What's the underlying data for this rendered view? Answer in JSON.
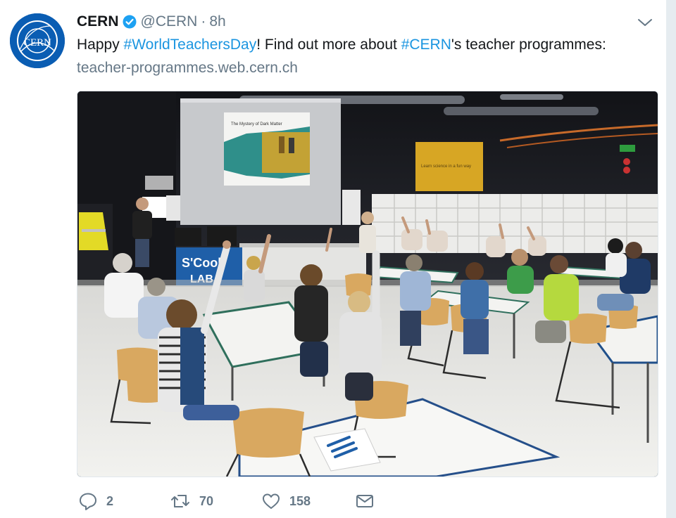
{
  "tweet": {
    "display_name": "CERN",
    "handle": "@CERN",
    "separator": "·",
    "time": "8h",
    "avatar_text": "CERN",
    "text_parts": [
      "Happy ",
      "#WorldTeachersDay",
      "! Find out more about ",
      "#CERN",
      "'s teacher programmes:"
    ],
    "link": "teacher-programmes.web.cern.ch"
  },
  "media": {
    "booth_sign": "S'Cool",
    "booth_sign_line2": "LAB",
    "slide_title": "The Mystery of Dark Matter",
    "wall_banner": "Learn science in a fun way"
  },
  "actions": {
    "replies": "2",
    "retweets": "70",
    "likes": "158"
  },
  "colors": {
    "brand": "#0a5db3",
    "link": "#1b95e0",
    "muted": "#657786",
    "verified": "#1da1f2"
  },
  "icons": [
    "verified-badge-icon",
    "chevron-down-icon",
    "reply-icon",
    "retweet-icon",
    "like-icon",
    "direct-message-icon"
  ]
}
